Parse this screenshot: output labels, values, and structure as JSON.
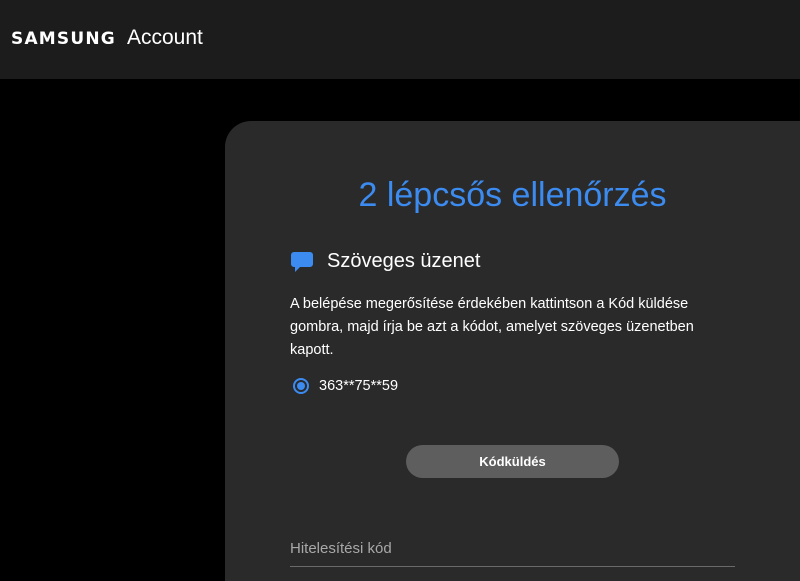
{
  "header": {
    "brand_logo": "SAMSUNG",
    "brand_product": "Account"
  },
  "card": {
    "title": "2 lépcsős ellenőrzés",
    "method": {
      "icon": "chat-bubble-icon",
      "label": "Szöveges üzenet"
    },
    "description": "A belépése megerősítése érdekében kattintson a Kód küldése gombra, majd írja be azt a kódot, amelyet szöveges üzenetben kapott.",
    "phone_option": {
      "number": "363**75**59",
      "selected": true
    },
    "send_button_label": "Kódküldés",
    "code_input": {
      "placeholder": "Hitelesítési kód",
      "value": ""
    }
  },
  "colors": {
    "accent": "#3c8bf0",
    "topbar_bg": "#1c1c1c",
    "card_bg": "#2a2a2a",
    "page_bg": "#000000",
    "button_bg": "#5e5e5e"
  }
}
